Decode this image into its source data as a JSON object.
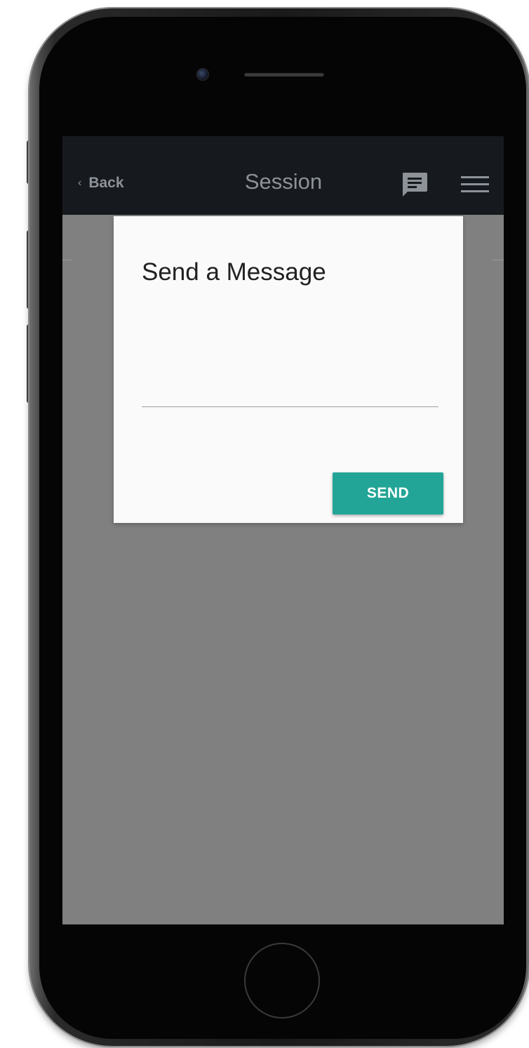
{
  "header": {
    "back_label": "Back",
    "title": "Session"
  },
  "dialog": {
    "title": "Send a Message",
    "input_value": "",
    "send_label": "SEND"
  },
  "icons": {
    "back": "chevron-left-icon",
    "chat": "chat-bubble-icon",
    "menu": "hamburger-menu-icon"
  },
  "colors": {
    "header_background": "#161a1e",
    "header_text": "#8d9299",
    "overlay": "#808080",
    "dialog_background": "#fafafa",
    "send_button": "#22a596"
  }
}
